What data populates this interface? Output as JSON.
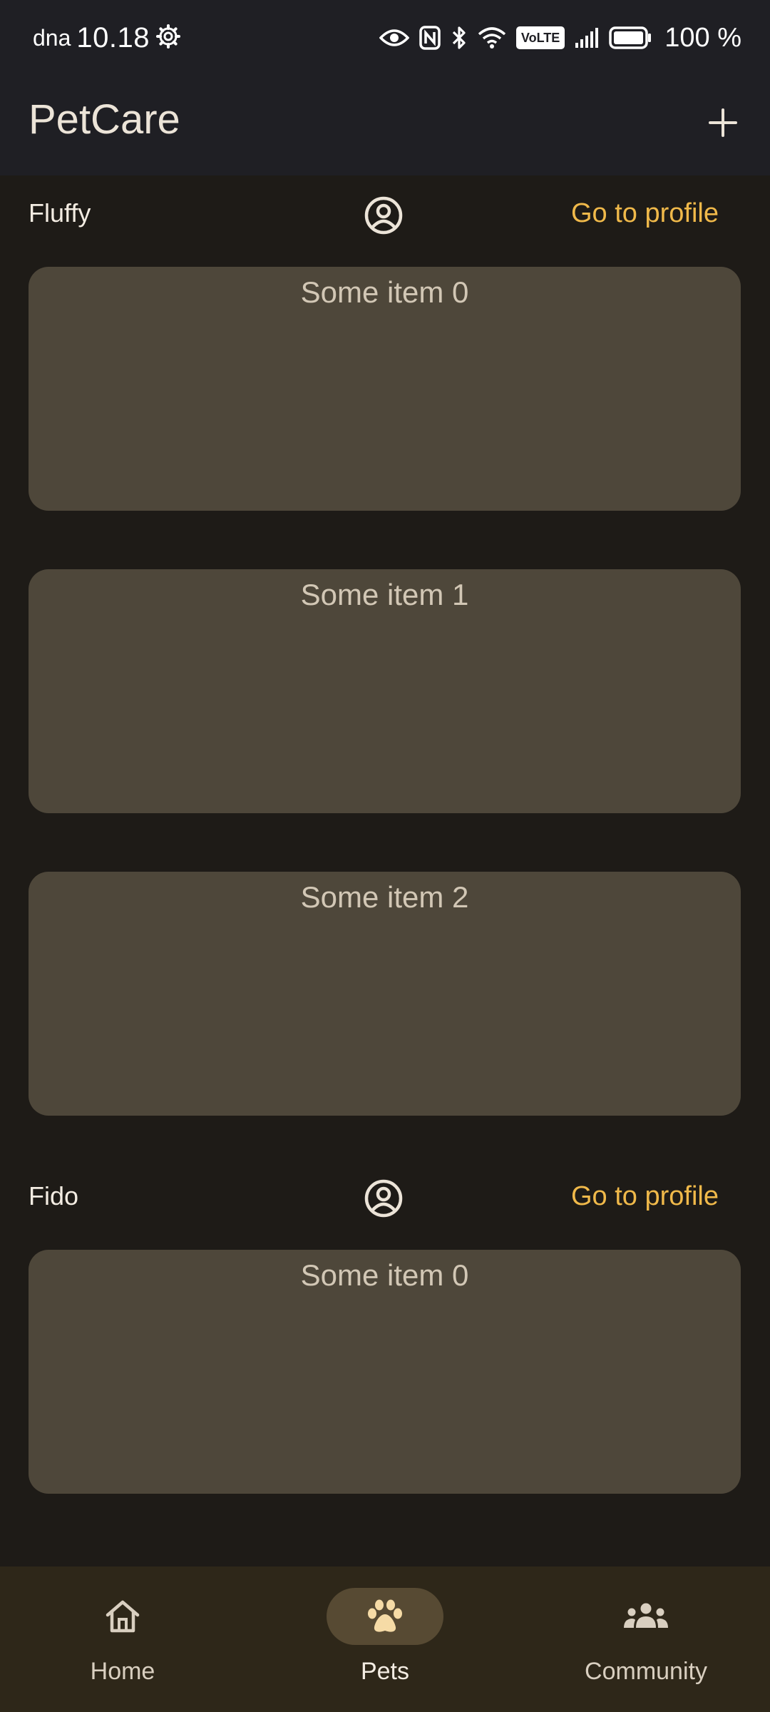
{
  "status_bar": {
    "carrier": "dna",
    "time": "10.18",
    "volte": "VoLTE",
    "battery": "100 %",
    "icons": [
      "settings-icon",
      "eye-icon",
      "nfc-icon",
      "bluetooth-icon",
      "wifi-icon",
      "volte-icon",
      "signal-icon",
      "battery-icon"
    ]
  },
  "app_bar": {
    "title": "PetCare",
    "add_icon": "plus-icon"
  },
  "pets": [
    {
      "name": "Fluffy",
      "profile_link": "Go to profile",
      "items": [
        "Some item 0",
        "Some item 1",
        "Some item 2"
      ]
    },
    {
      "name": "Fido",
      "profile_link": "Go to profile",
      "items": [
        "Some item 0"
      ]
    }
  ],
  "bottom_nav": {
    "items": [
      {
        "label": "Home",
        "icon": "home-icon",
        "active": false
      },
      {
        "label": "Pets",
        "icon": "paw-icon",
        "active": true
      },
      {
        "label": "Community",
        "icon": "community-icon",
        "active": false
      }
    ]
  },
  "colors": {
    "background": "#1e1b17",
    "app_bar": "#1f1f24",
    "card": "#4e473a",
    "accent_link": "#f0b94a",
    "nav_background": "#2e2719",
    "nav_active_pill": "#574a33"
  }
}
